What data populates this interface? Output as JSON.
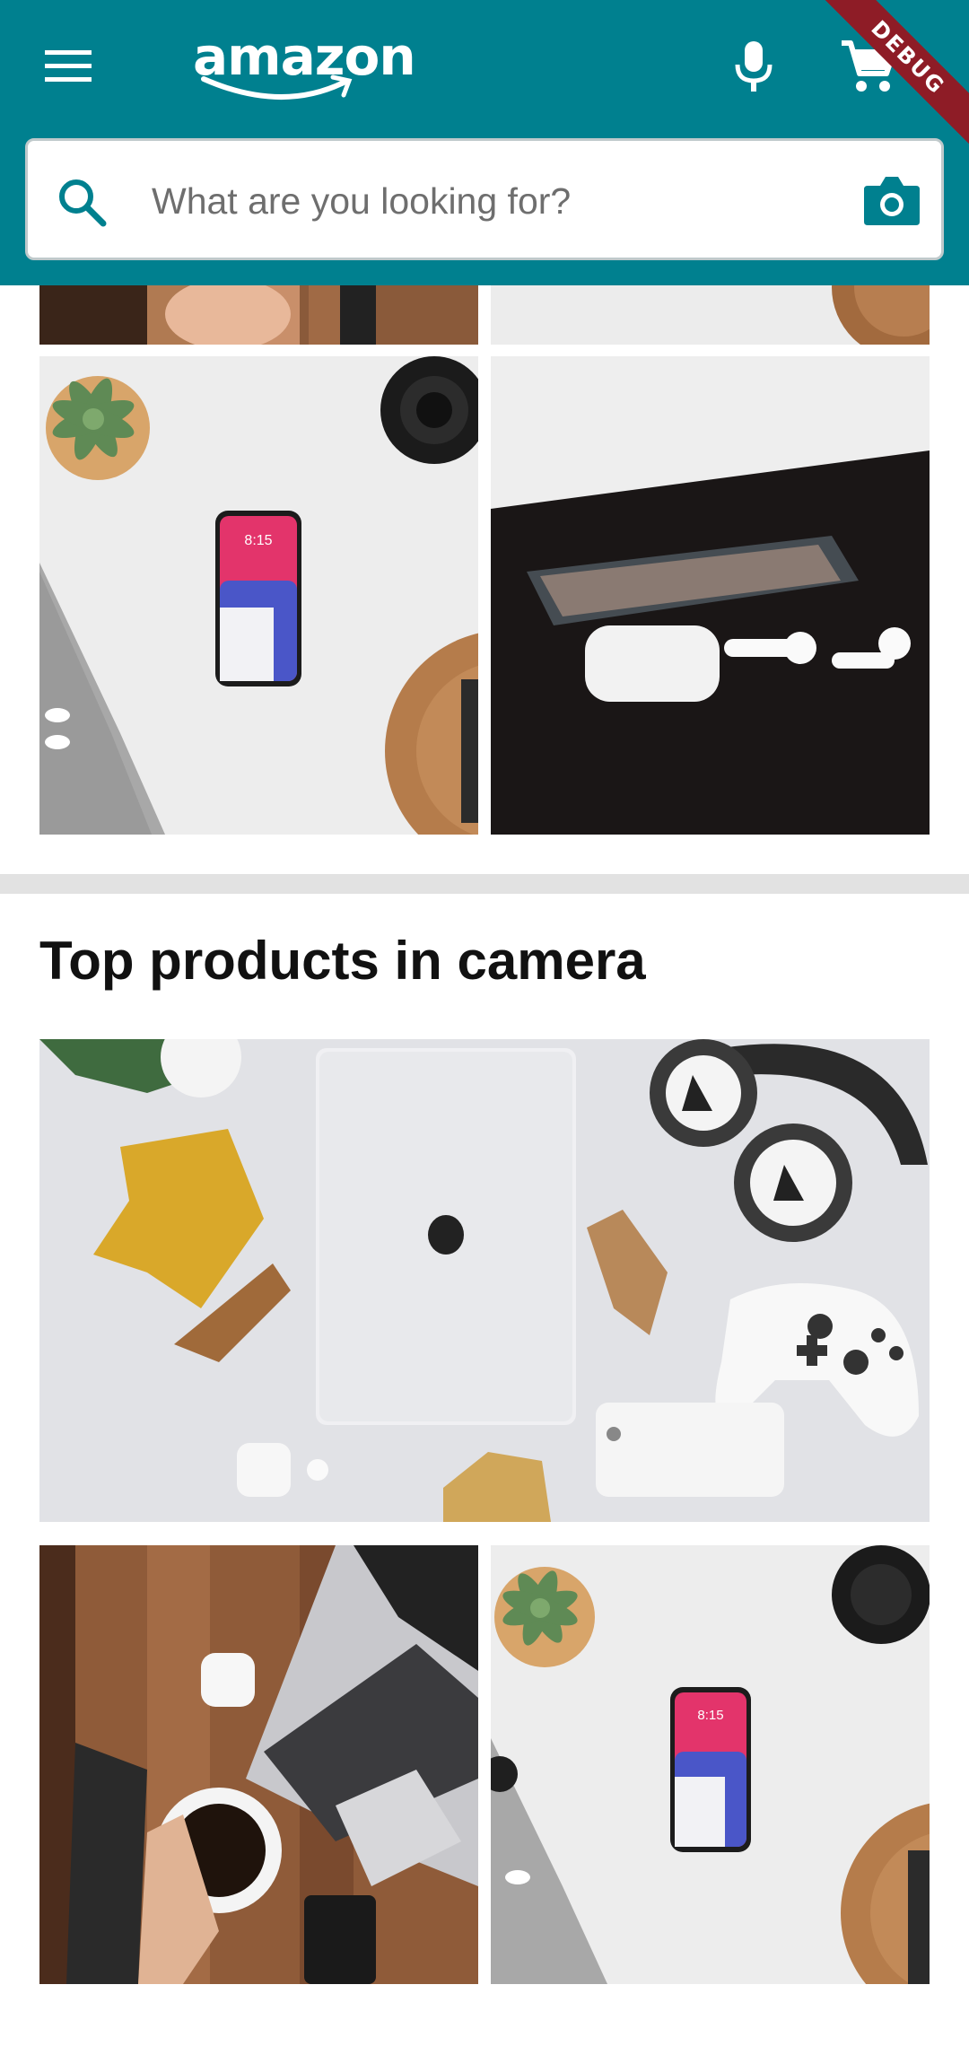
{
  "app_bar": {
    "logo_text": "amazon",
    "menu_icon": "menu-icon",
    "mic_icon": "mic-icon",
    "cart_icon": "shopping-cart-icon",
    "debug_banner": "DEBUG",
    "background_color": "#00808f"
  },
  "search": {
    "placeholder": "What are you looking for?",
    "value": "",
    "search_icon": "search-icon",
    "camera_icon": "camera-icon",
    "accent_color": "#00808f"
  },
  "product_grid": {
    "tiles": [
      {
        "image": "coffee-laptop-wood-desk"
      },
      {
        "image": "white-desk-cork-coaster"
      },
      {
        "image": "iphone-white-desk-succulent"
      },
      {
        "image": "iphone-airpods-black-table"
      }
    ]
  },
  "camera_section": {
    "title": "Top products in camera",
    "tiles": [
      {
        "image": "macbook-headphones-controller-flatlay"
      },
      {
        "image": "coffee-laptop-wood-desk"
      },
      {
        "image": "iphone-white-desk-succulent"
      }
    ]
  }
}
